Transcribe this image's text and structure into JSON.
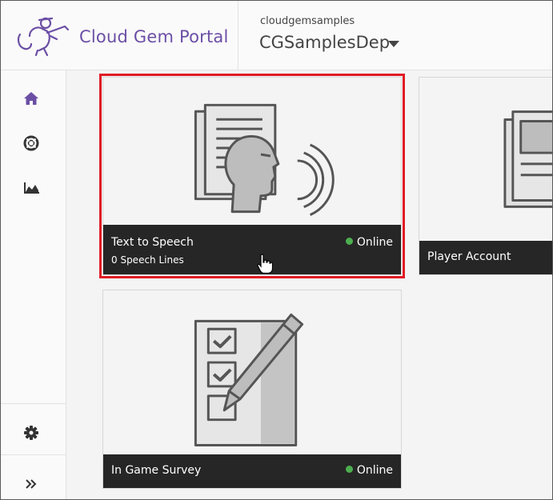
{
  "header": {
    "brand": "Cloud Gem Portal",
    "project_name": "cloudgemsamples",
    "deployment": "CGSamplesDep"
  },
  "sidebar": {
    "items": [
      {
        "icon": "home-icon"
      },
      {
        "icon": "support-icon"
      },
      {
        "icon": "analytics-icon"
      },
      {
        "icon": "gear-icon"
      },
      {
        "icon": "expand-icon"
      }
    ]
  },
  "cards": [
    {
      "title": "Text to Speech",
      "subtitle": "0 Speech Lines",
      "status": "Online",
      "status_color": "#4caf50",
      "selected": true
    },
    {
      "title": "Player Account"
    },
    {
      "title": "In Game Survey",
      "status": "Online",
      "status_color": "#4caf50"
    }
  ],
  "colors": {
    "brand": "#6b4fa5",
    "highlight": "#e01b24",
    "footer": "#262626"
  }
}
